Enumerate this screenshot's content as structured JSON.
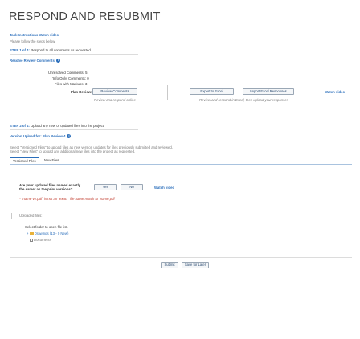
{
  "page": {
    "title": "RESPOND AND RESUBMIT"
  },
  "task": {
    "instructions_link": "Task Instructions",
    "watch_video": "Watch video",
    "subtitle": "Please follow the steps below"
  },
  "step1": {
    "label": "STEP 1 of 4:",
    "text": "Respond to all comments as requested",
    "review_comments_label": "Resolve Review Comments",
    "unresolved_label": "Unresolved Comments:",
    "unresolved_count": "5",
    "only_comments_label": "'Info Only' Comments:",
    "only_comments_count": "0",
    "files_markups_label": "Files with Markups:",
    "files_markups_count": "3",
    "plan_review_label": "Plan Review:",
    "review_comments_btn": "Review Comments",
    "review_hint": "Review and respond online",
    "export_btn": "Export to Excel",
    "import_btn": "Import Excel Responses",
    "export_hint": "Review and respond in Excel, then upload your responses",
    "watch_video": "Watch video"
  },
  "step2": {
    "label": "STEP 2 of 4:",
    "text": "Upload any new or updated files into the project",
    "version_label": "Version Upload for: Plan Review 4",
    "instructions_1": "Select \"Versioned Files\" to upload files as new version updates for files previously submitted and reviewed.",
    "instructions_2": "Select \"New Files\" to upload any additional new files into the project as requested.",
    "tab_versioned": "Versioned Files",
    "tab_new": "New Files",
    "question_1": "Are your updated files named exactly",
    "question_2": "the same* as the prior versions?",
    "yes_btn": "Yes",
    "no_btn": "No",
    "watch_video": "Watch video",
    "warning_note": "* \"name-v2.pdf\" is not an \"exact\" file name match to \"name.pdf\"",
    "uploaded_files_label": "Uploaded files:",
    "select_folder_hint": "Select folder to open file list.",
    "folder_drawings": "Drawings (13 - 0 New)",
    "folder_documents": "Documents"
  },
  "footer": {
    "submit_btn": "Submit",
    "save_later_btn": "Save for Later"
  },
  "colors": {
    "accent": "#2a6ebb",
    "warning": "#c0392b",
    "folder": "#e8b23a"
  }
}
